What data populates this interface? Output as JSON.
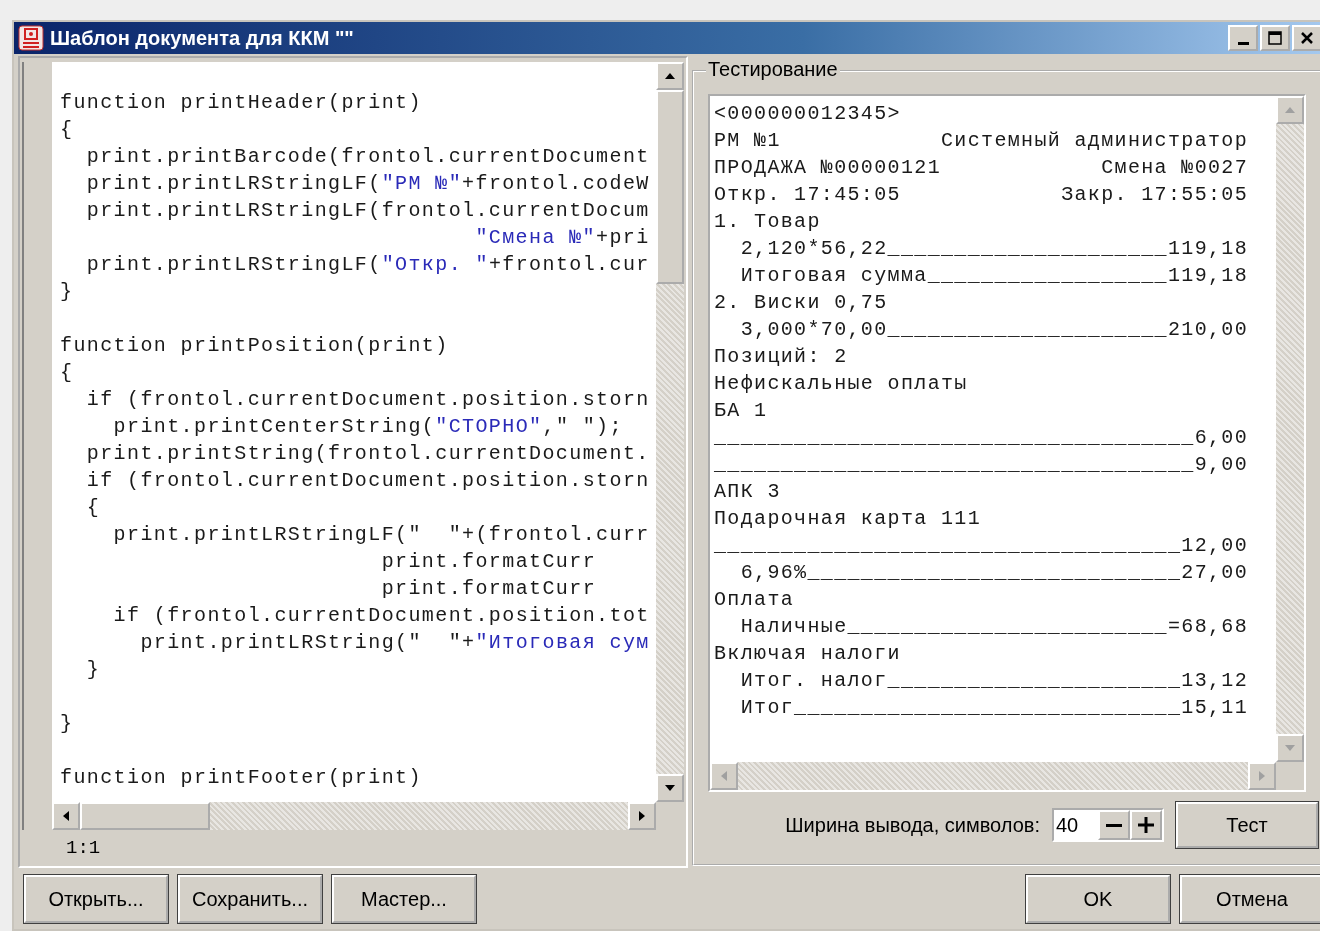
{
  "window": {
    "title": "Шаблон документа для ККМ \"\""
  },
  "editor": {
    "lines": [
      {
        "kind": "code",
        "segments": [
          {
            "text": "function printHeader(print)",
            "kind": "plain"
          }
        ]
      },
      {
        "kind": "code",
        "segments": [
          {
            "text": "{",
            "kind": "plain"
          }
        ]
      },
      {
        "kind": "code",
        "segments": [
          {
            "text": "  print.printBarcode(frontol.currentDocument",
            "kind": "plain"
          }
        ]
      },
      {
        "kind": "code",
        "segments": [
          {
            "text": "  print.printLRStringLF(",
            "kind": "plain"
          },
          {
            "text": "\"РМ №\"",
            "kind": "string"
          },
          {
            "text": "+frontol.codeW",
            "kind": "plain"
          }
        ]
      },
      {
        "kind": "code",
        "segments": [
          {
            "text": "  print.printLRStringLF(frontol.currentDocum",
            "kind": "plain"
          }
        ]
      },
      {
        "kind": "continuation",
        "segments": [
          {
            "text": "\"Смена №\"",
            "kind": "string"
          },
          {
            "text": "+pri",
            "kind": "plain"
          }
        ]
      },
      {
        "kind": "code",
        "segments": [
          {
            "text": "  print.printLRStringLF(",
            "kind": "plain"
          },
          {
            "text": "\"Откр. \"",
            "kind": "string"
          },
          {
            "text": "+frontol.cur",
            "kind": "plain"
          }
        ]
      },
      {
        "kind": "code",
        "segments": [
          {
            "text": "}",
            "kind": "plain"
          }
        ]
      },
      {
        "kind": "blank"
      },
      {
        "kind": "code",
        "segments": [
          {
            "text": "function printPosition(print)",
            "kind": "plain"
          }
        ]
      },
      {
        "kind": "code",
        "segments": [
          {
            "text": "{",
            "kind": "plain"
          }
        ]
      },
      {
        "kind": "code",
        "segments": [
          {
            "text": "  if (frontol.currentDocument.position.storn",
            "kind": "plain"
          }
        ]
      },
      {
        "kind": "code",
        "segments": [
          {
            "text": "    print.printCenterString(",
            "kind": "plain"
          },
          {
            "text": "\"СТОРНО\"",
            "kind": "string"
          },
          {
            "text": ",\" \");",
            "kind": "plain"
          }
        ]
      },
      {
        "kind": "code",
        "segments": [
          {
            "text": "  print.printString(frontol.currentDocument.",
            "kind": "plain"
          }
        ]
      },
      {
        "kind": "code",
        "segments": [
          {
            "text": "  if (frontol.currentDocument.position.storn",
            "kind": "plain"
          }
        ]
      },
      {
        "kind": "code",
        "segments": [
          {
            "text": "  {",
            "kind": "plain"
          }
        ]
      },
      {
        "kind": "code",
        "segments": [
          {
            "text": "    print.printLRStringLF(\"  \"+(frontol.curr",
            "kind": "plain"
          }
        ]
      },
      {
        "kind": "code",
        "segments": [
          {
            "text": "                        print.formatCurr",
            "kind": "plain"
          }
        ]
      },
      {
        "kind": "code",
        "segments": [
          {
            "text": "                        print.formatCurr",
            "kind": "plain"
          }
        ]
      },
      {
        "kind": "code",
        "segments": [
          {
            "text": "    if (frontol.currentDocument.position.tot",
            "kind": "plain"
          }
        ]
      },
      {
        "kind": "code",
        "segments": [
          {
            "text": "      print.printLRString(\"  \"+",
            "kind": "plain"
          },
          {
            "text": "\"Итоговая сум",
            "kind": "string"
          }
        ]
      },
      {
        "kind": "code",
        "segments": [
          {
            "text": "  }",
            "kind": "plain"
          }
        ]
      },
      {
        "kind": "blank"
      },
      {
        "kind": "code",
        "segments": [
          {
            "text": "}",
            "kind": "plain"
          }
        ]
      },
      {
        "kind": "blank"
      },
      {
        "kind": "code",
        "segments": [
          {
            "text": "function printFooter(print)",
            "kind": "plain"
          }
        ]
      }
    ],
    "cursor_position": "1:1"
  },
  "test_panel": {
    "title": "Тестирование",
    "receipt_lines": [
      "<000000012345>",
      "РМ №1            Системный администратор",
      "ПРОДАЖА №00000121            Смена №0027",
      "Откр. 17:45:05            Закр. 17:55:05",
      "1. Товар",
      "  2,120*56,22_____________________119,18",
      "  Итоговая сумма__________________119,18",
      "2. Виски 0,75",
      "  3,000*70,00_____________________210,00",
      "Позиций: 2",
      "Нефискальные оплаты",
      "БА 1",
      "____________________________________6,00",
      "____________________________________9,00",
      "АПК 3",
      "Подарочная карта 111",
      "___________________________________12,00",
      "  6,96%____________________________27,00",
      "Оплата",
      "  Наличные________________________=68,68",
      "Включая налоги",
      "  Итог. налог______________________13,12",
      "  Итог_____________________________15,11"
    ],
    "width_label": "Ширина вывода, символов:",
    "width_value": "40",
    "test_button": "Тест"
  },
  "left_buttons": [
    "Открыть...",
    "Сохранить...",
    "Мастер..."
  ],
  "dialog_buttons": [
    "OK",
    "Отмена"
  ]
}
